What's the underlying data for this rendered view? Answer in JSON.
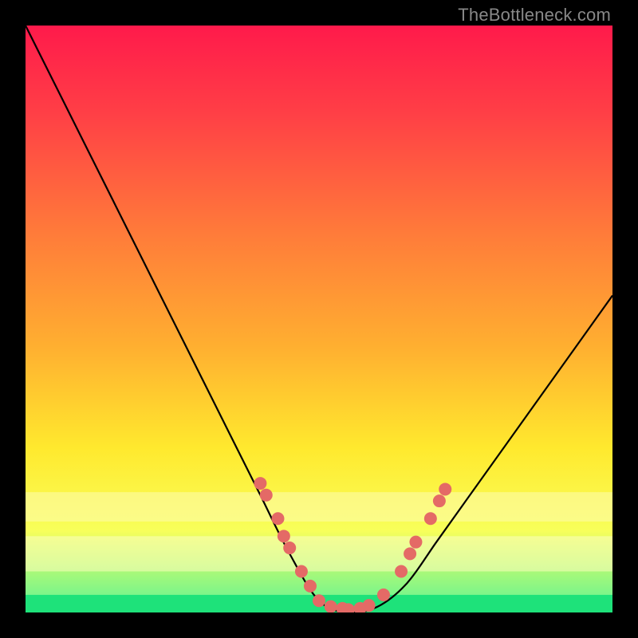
{
  "watermark": "TheBottleneck.com",
  "chart_data": {
    "type": "line",
    "title": "",
    "xlabel": "",
    "ylabel": "",
    "xlim": [
      0,
      100
    ],
    "ylim": [
      0,
      100
    ],
    "series": [
      {
        "name": "bottleneck-curve",
        "x": [
          0,
          5,
          10,
          15,
          20,
          25,
          30,
          35,
          40,
          45,
          50,
          55,
          60,
          65,
          70,
          75,
          80,
          85,
          90,
          95,
          100
        ],
        "y": [
          100,
          90,
          80,
          70,
          60,
          50,
          40,
          30,
          20,
          10,
          2,
          0,
          1,
          5,
          12,
          19,
          26,
          33,
          40,
          47,
          54
        ]
      }
    ],
    "markers": {
      "name": "highlight-dots",
      "color": "#e46a66",
      "radius": 8,
      "points": [
        {
          "x": 40,
          "y": 22
        },
        {
          "x": 41,
          "y": 20
        },
        {
          "x": 43,
          "y": 16
        },
        {
          "x": 44,
          "y": 13
        },
        {
          "x": 45,
          "y": 11
        },
        {
          "x": 47,
          "y": 7
        },
        {
          "x": 48.5,
          "y": 4.5
        },
        {
          "x": 50,
          "y": 2
        },
        {
          "x": 52,
          "y": 1
        },
        {
          "x": 54,
          "y": 0.7
        },
        {
          "x": 55,
          "y": 0.5
        },
        {
          "x": 57,
          "y": 0.7
        },
        {
          "x": 58.5,
          "y": 1.2
        },
        {
          "x": 61,
          "y": 3
        },
        {
          "x": 64,
          "y": 7
        },
        {
          "x": 65.5,
          "y": 10
        },
        {
          "x": 66.5,
          "y": 12
        },
        {
          "x": 69,
          "y": 16
        },
        {
          "x": 70.5,
          "y": 19
        },
        {
          "x": 71.5,
          "y": 21
        }
      ]
    },
    "bands": [
      {
        "name": "green-band",
        "y_center": 1.5,
        "height": 3,
        "color": "#1ee27a"
      },
      {
        "name": "pale-band-1",
        "y_center": 10,
        "height": 6,
        "color": "#fdfec0"
      },
      {
        "name": "pale-band-2",
        "y_center": 18,
        "height": 5,
        "color": "#fdfcb0"
      }
    ],
    "gradient_stops": [
      {
        "offset": 0,
        "color": "#ff1a4b"
      },
      {
        "offset": 15,
        "color": "#ff3f46"
      },
      {
        "offset": 35,
        "color": "#ff7a3a"
      },
      {
        "offset": 55,
        "color": "#ffb030"
      },
      {
        "offset": 72,
        "color": "#ffe92e"
      },
      {
        "offset": 86,
        "color": "#f8ff5a"
      },
      {
        "offset": 97,
        "color": "#7cf58a"
      },
      {
        "offset": 100,
        "color": "#1ee27a"
      }
    ]
  }
}
